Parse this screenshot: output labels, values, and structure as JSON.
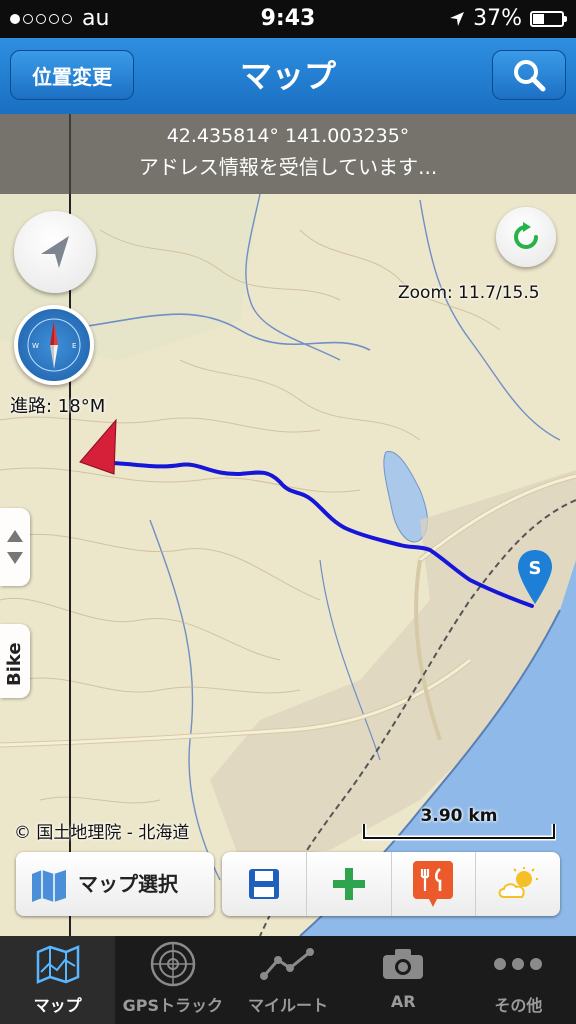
{
  "status_bar": {
    "carrier": "au",
    "time": "9:43",
    "battery": "37%",
    "battery_level": 0.37,
    "signal_bars": 1
  },
  "nav": {
    "left_button": "位置変更",
    "title": "マップ",
    "right_icon": "search-icon"
  },
  "info": {
    "coordinates": "42.435814° 141.003235°",
    "address_status": "アドレス情報を受信しています..."
  },
  "map": {
    "zoom": "Zoom: 11.7/15.5",
    "heading": "進路: 18°M",
    "side_tab": "Bike",
    "copyright": "© 国土地理院 - 北海道",
    "scale": "3.90 km",
    "start_marker": "S",
    "route_color": "#1616d8",
    "sea_color": "#8fb9e8"
  },
  "map_buttons": {
    "map_select": "マップ選択",
    "tools": [
      "save-icon",
      "add-icon",
      "restaurant-icon",
      "weather-icon"
    ]
  },
  "tabs": [
    {
      "label": "マップ",
      "icon": "map-icon",
      "active": true
    },
    {
      "label": "GPSトラック",
      "icon": "radar-icon",
      "active": false
    },
    {
      "label": "マイルート",
      "icon": "route-icon",
      "active": false
    },
    {
      "label": "AR",
      "icon": "camera-icon",
      "active": false
    },
    {
      "label": "その他",
      "icon": "more-icon",
      "active": false
    }
  ]
}
